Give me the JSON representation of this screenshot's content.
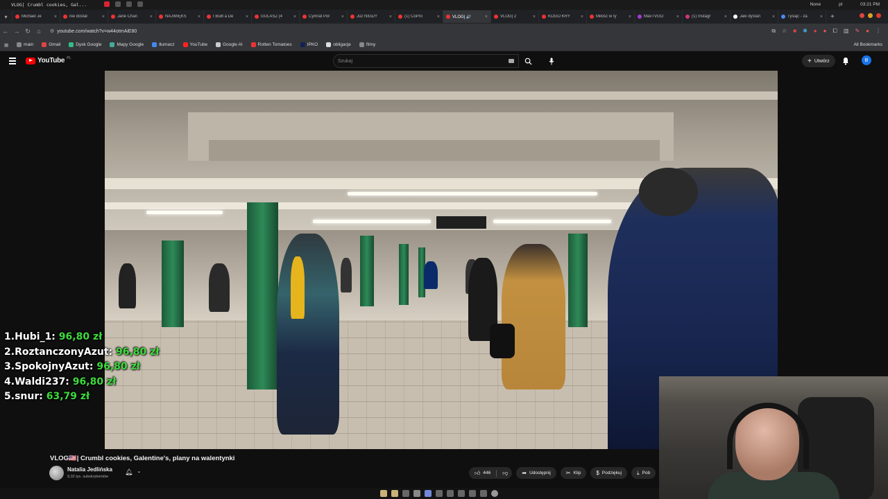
{
  "os": {
    "window_title": "VLOG| Crumbl cookies, Gal...",
    "right": [
      "None",
      "pl",
      "03:21 PM"
    ]
  },
  "tabs": [
    {
      "label": "Michael Je"
    },
    {
      "label": "nie dostał"
    },
    {
      "label": "Jane Chan"
    },
    {
      "label": "NAJWIĘKS"
    },
    {
      "label": "I Built a De"
    },
    {
      "label": "GULASZ (4"
    },
    {
      "label": "Cymrat Poł"
    },
    {
      "label": "Już NIGDY"
    },
    {
      "label": "(1) CoPro"
    },
    {
      "label": "VLOG| 🔊",
      "active": true
    },
    {
      "label": "VLOG| 2"
    },
    {
      "label": "KOGO KRY"
    },
    {
      "label": "Miłość w ry"
    },
    {
      "label": "MaxTVGO"
    },
    {
      "label": "(1) Instagr"
    },
    {
      "label": "Jaki dystan"
    },
    {
      "label": "Tysiąc - za"
    }
  ],
  "address": {
    "url": "youtube.com/watch?v=w44otmAiE80"
  },
  "bookmarks": [
    {
      "label": "main"
    },
    {
      "label": "Gmail"
    },
    {
      "label": "Dysk Google"
    },
    {
      "label": "Mapy Google"
    },
    {
      "label": "tłumacz"
    },
    {
      "label": "YouTube"
    },
    {
      "label": "Google AI"
    },
    {
      "label": "Rotten Tomatoes"
    },
    {
      "label": "IPKO"
    },
    {
      "label": "obligacje"
    },
    {
      "label": "filmy"
    }
  ],
  "bookmarks_all": "All Bookmarks",
  "yt": {
    "brand": "YouTube",
    "region": "PL",
    "search_placeholder": "Szukaj",
    "create_label": "Utwórz",
    "avatar_letter": "B"
  },
  "leaderboard": [
    {
      "rank": "1.",
      "name": "Hubi_1:",
      "amount": "96,80 zł"
    },
    {
      "rank": "2.",
      "name": "RoztanczonyAzut:",
      "amount": "96,80 zł"
    },
    {
      "rank": "3.",
      "name": "SpokojnyAzut:",
      "amount": "96,80 zł"
    },
    {
      "rank": "4.",
      "name": "Waldi237:",
      "amount": "96,80 zł"
    },
    {
      "rank": "5.",
      "name": "snur:",
      "amount": "63,79 zł"
    }
  ],
  "video": {
    "title": "VLOG🇺🇸| Crumbl cookies, Galentine's, plany na walentynki",
    "channel": "Natalia Jedlińska",
    "subscribers": "9,32 tys. subskrybentów"
  },
  "actions": {
    "likes": "446",
    "share": "Udostępnij",
    "clip": "Klip",
    "thanks": "Podziękuj",
    "download": "Pob"
  },
  "colors": {
    "accent": "#ff0000",
    "leaderboard_amount": "#3ddc3d"
  }
}
